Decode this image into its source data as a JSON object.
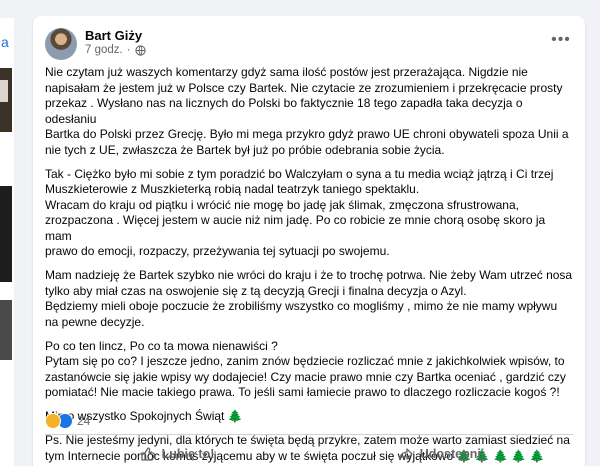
{
  "left_panel": {
    "link_char": "a"
  },
  "post": {
    "author": "Bart Giży",
    "time": "7 godz.",
    "paragraphs": [
      "Nie czytam już waszych komentarzy gdyż sama ilość postów jest przerażająca. Nigdzie nie\nnapisałam że jestem już w Polsce czy Bartek. Nie czytacie ze zrozumieniem i przekręcacie prosty\nprzekaz . Wysłano nas na licznych do Polski bo faktycznie 18 tego zapadła taka decyzja o odesłaniu\nBartka do Polski przez Grecję. Było mi mega przykro gdyż prawo UE chroni obywateli spoza Unii a\nnie tych z UE, zwłaszcza że Bartek był już po próbie odebrania sobie życia.",
      "Tak - Ciężko było mi sobie z tym poradzić bo Walczyłam o syna a tu media wciąż jątrzą i Ci trzej\nMuszkieterowie z Muszkieterką robią nadal teatrzyk taniego spektaklu.\nWracam do kraju od piątku i wrócić nie mogę bo jadę jak ślimak, zmęczona sfrustrowana,\nzrozpaczona . Więcej jestem w aucie niż nim jadę. Po co robicie ze mnie chorą osobę skoro ja mam\nprawo do emocji, rozpaczy, przeżywania tej sytuacji po swojemu.",
      "Mam nadzieję że Bartek szybko nie wróci do kraju i że to trochę potrwa. Nie żeby Wam utrzeć nosa\ntylko aby miał czas na oswojenie się z tą decyzją Grecji i finalna decyzja o Azyl.\nBędziemy mieli oboje poczucie że zrobiliśmy wszystko co mogliśmy , mimo że nie mamy wpływu\nna pewne decyzje.",
      "Po co ten lincz, Po co ta mowa nienawiści ?\nPytam się po co? I jeszcze jedno, zanim znów będziecie rozliczać mnie z jakichkolwiek wpisów, to\nzastanówcie się jakie wpisy wy dodajecie! Czy macie prawo mnie czy Bartka oceniać , gardzić czy\npomiatać! Nie macie takiego prawa. To jeśli sami łamiecie prawo to dlaczego rozliczacie kogoś ?!",
      "Mimo wszystko Spokojnych Świąt",
      "Ps. Nie jesteśmy jedyni, dla których te święta będą przykre, zatem może warto zamiast siedzieć na\ntym Internecie pomóc komuś żyjącemu aby w te święta poczuł się wyjątkowo"
    ],
    "tree_single": "🌲",
    "tree_multi": "🌲 🌲 🌲 🌲 🌲",
    "reaction_count": "24",
    "like_label": "Lubię to!",
    "share_label": "Udostępnij"
  }
}
